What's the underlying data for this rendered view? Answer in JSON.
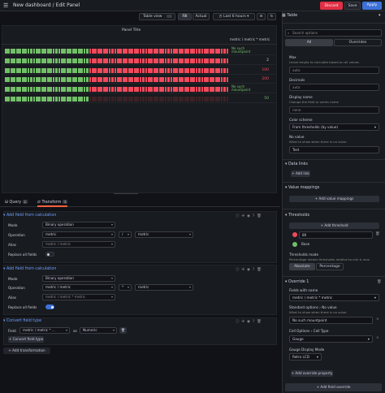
{
  "header": {
    "title": "New dashboard / Edit Panel",
    "discard": "Discard",
    "save": "Save",
    "apply": "Apply"
  },
  "viz_toolbar": {
    "table_view": "Table view",
    "fill": "Fill",
    "actual": "Actual",
    "time_range": "Last 6 hours",
    "viz_type": "Table"
  },
  "panel": {
    "title": "Panel Title",
    "column_header": "metric / metric * metric",
    "rows": [
      {
        "green": 1.0,
        "red": 1.0,
        "value": "No such mountpoint",
        "value_color": "#73bf69"
      },
      {
        "green": 1.0,
        "red": 1.0,
        "value": "2",
        "value_color": "#ccccdc"
      },
      {
        "green": 1.0,
        "red": 1.0,
        "value": "100",
        "value_color": "#f2495c"
      },
      {
        "green": 1.0,
        "red": 1.0,
        "value": "200",
        "value_color": "#f2495c"
      },
      {
        "green": 1.0,
        "red": 1.0,
        "value": "No such mountpoint",
        "value_color": "#73bf69"
      },
      {
        "green": 1.0,
        "red": 0.0,
        "value": "50",
        "value_color": "#73bf69"
      }
    ]
  },
  "query_tabs": {
    "query": "Query",
    "query_count": "1",
    "transform": "Transform",
    "transform_count": "3"
  },
  "transforms": [
    {
      "header": "Add field from calculation",
      "mode_label": "Mode",
      "mode": "Binary operation",
      "operation_label": "Operation",
      "left": "metric",
      "op": "/",
      "right": "metric",
      "alias_label": "Alias",
      "alias_placeholder": "metric / metric",
      "replace_label": "Replace all fields",
      "replace_on": false
    },
    {
      "header": "Add field from calculation",
      "mode_label": "Mode",
      "mode": "Binary operation",
      "operation_label": "Operation",
      "left": "metric / metric",
      "op": "*",
      "right": "metric",
      "alias_label": "Alias",
      "alias_placeholder": "metric / metric * metric",
      "replace_label": "Replace all fields",
      "replace_on": true
    }
  ],
  "convert": {
    "header": "Convert field type",
    "field_label": "Field",
    "field_value": "metric / metric * ...",
    "as_label": "as",
    "as_value": "Numeric",
    "add_field_type": "Convert field type",
    "add_transformation": "Add transformation"
  },
  "options": {
    "search_placeholder": "Search options",
    "tab_all": "All",
    "tab_overrides": "Overrides",
    "max_label": "Max",
    "max_desc": "Leave empty to calculate based on all values",
    "max_value": "auto",
    "decimals_label": "Decimals",
    "decimals_value": "auto",
    "display_name_label": "Display name",
    "display_name_desc": "Change the field or series name",
    "display_name_value": "none",
    "color_scheme_label": "Color scheme",
    "color_scheme_value": "From thresholds (by value)",
    "no_value_label": "No value",
    "no_value_desc": "What to show when there is no value",
    "no_value_value": "Test",
    "data_links": "Data links",
    "add_link": "Add link",
    "value_mappings": "Value mappings",
    "add_value_mappings": "Add value mappings",
    "thresholds": "Thresholds",
    "add_threshold": "Add threshold",
    "threshold_red_value": "80",
    "threshold_base": "Base",
    "threshold_red_color": "#f2495c",
    "threshold_green_color": "#73bf69",
    "thresholds_mode_label": "Thresholds mode",
    "thresholds_mode_desc": "Percentage means thresholds relative to min & max",
    "mode_absolute": "Absolute",
    "mode_percentage": "Percentage",
    "override_header": "Override 1",
    "fields_with_name_label": "Fields with name",
    "fields_with_name_value": "metric / metric * metric",
    "standard_options": "Standard options",
    "no_value_sub": "No value",
    "no_value_sub_desc": "What to show when there is no value",
    "no_value_override": "No such mountpoint",
    "cell_options": "Cell Options",
    "cell_type": "Cell Type",
    "cell_type_value": "Gauge",
    "gauge_display_label": "Gauge Display Mode",
    "gauge_display_value": "Retro LCD",
    "add_override_property": "Add override property",
    "add_field_override": "Add field override"
  }
}
